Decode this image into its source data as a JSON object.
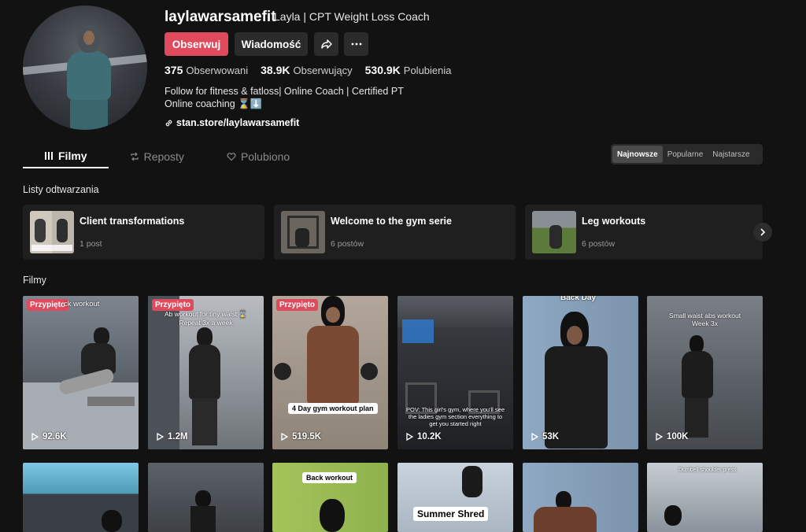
{
  "profile": {
    "username": "laylawarsamefit",
    "nickname": "Layla | CPT Weight Loss Coach",
    "follow_label": "Obserwuj",
    "message_label": "Wiadomość",
    "share_icon": "share-icon",
    "more_icon": "more-icon",
    "stats": [
      {
        "value": "375",
        "label": "Obserwowani"
      },
      {
        "value": "38.9K",
        "label": "Obserwujący"
      },
      {
        "value": "530.9K",
        "label": "Polubienia"
      }
    ],
    "bio_line1": "Follow for fitness & fatloss| Online Coach | Certified PT",
    "bio_line2": "Online coaching ⌛⬇️",
    "link": "stan.store/laylawarsamefit"
  },
  "tabs": [
    {
      "label": "Filmy",
      "icon": "grid-icon"
    },
    {
      "label": "Reposty",
      "icon": "repost-icon"
    },
    {
      "label": "Polubiono",
      "icon": "heart-icon"
    }
  ],
  "sort": [
    "Najnowsze",
    "Popularne",
    "Najstarsze"
  ],
  "playlists_title": "Listy odtwarzania",
  "playlists": [
    {
      "title": "Client transformations",
      "count": "1 post"
    },
    {
      "title": "Welcome to the gym serie",
      "count": "6 postów"
    },
    {
      "title": "Leg workouts",
      "count": "6 postów"
    }
  ],
  "videos_title": "Filmy",
  "pinned_label": "Przypięto",
  "videos": [
    {
      "views": "92.6K",
      "caption": "ck workout"
    },
    {
      "views": "1.2M",
      "caption": "Ab workout for tiny waist ⌛ Repeat 3x a week"
    },
    {
      "views": "519.5K",
      "caption": "4 Day gym workout plan"
    },
    {
      "views": "10.2K",
      "caption": "POV: This girl's gym, where you'll see the ladies gym section everything to get you started right"
    },
    {
      "views": "53K",
      "caption": "Back Day"
    },
    {
      "views": "100K",
      "caption": "Small waist abs workout Week 3x"
    }
  ],
  "videos_row2": [
    {
      "caption": ""
    },
    {
      "caption": ""
    },
    {
      "caption": "Back workout"
    },
    {
      "caption": "Summer Shred"
    },
    {
      "caption": ""
    },
    {
      "caption": "Dumbell shoulder press"
    }
  ],
  "colors": {
    "accent": "#e04a5d",
    "background": "#121212",
    "card": "#1f1f1f"
  }
}
